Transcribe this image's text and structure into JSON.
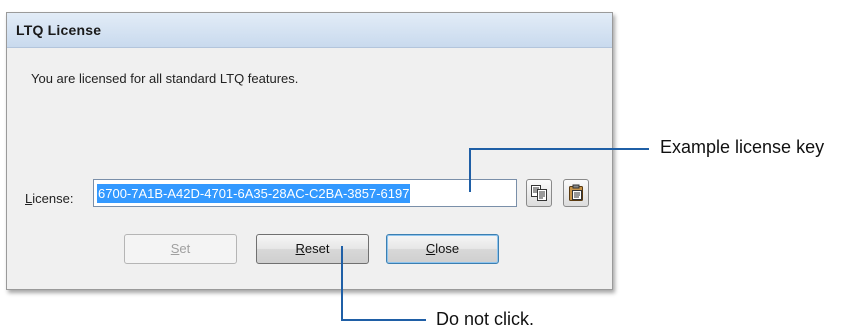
{
  "dialog": {
    "title": "LTQ License",
    "message": "You are licensed for all standard LTQ features.",
    "license_label_mnemonic": "L",
    "license_label_rest": "icense:",
    "license_value": "6700-7A1B-A42D-4701-6A35-28AC-C2BA-3857-6197",
    "copy_icon": "copy-icon",
    "paste_icon": "paste-icon",
    "buttons": {
      "set": {
        "mnemonic": "S",
        "rest": "et",
        "enabled": false
      },
      "reset": {
        "mnemonic": "R",
        "rest": "eset",
        "enabled": true
      },
      "close": {
        "mnemonic": "C",
        "rest": "lose",
        "enabled": true
      }
    }
  },
  "callouts": {
    "license_key": "Example license key",
    "reset": "Do not click."
  },
  "colors": {
    "callout_line": "#1f5fa6",
    "selection": "#3399ff",
    "titlebar": "#c9daee"
  }
}
